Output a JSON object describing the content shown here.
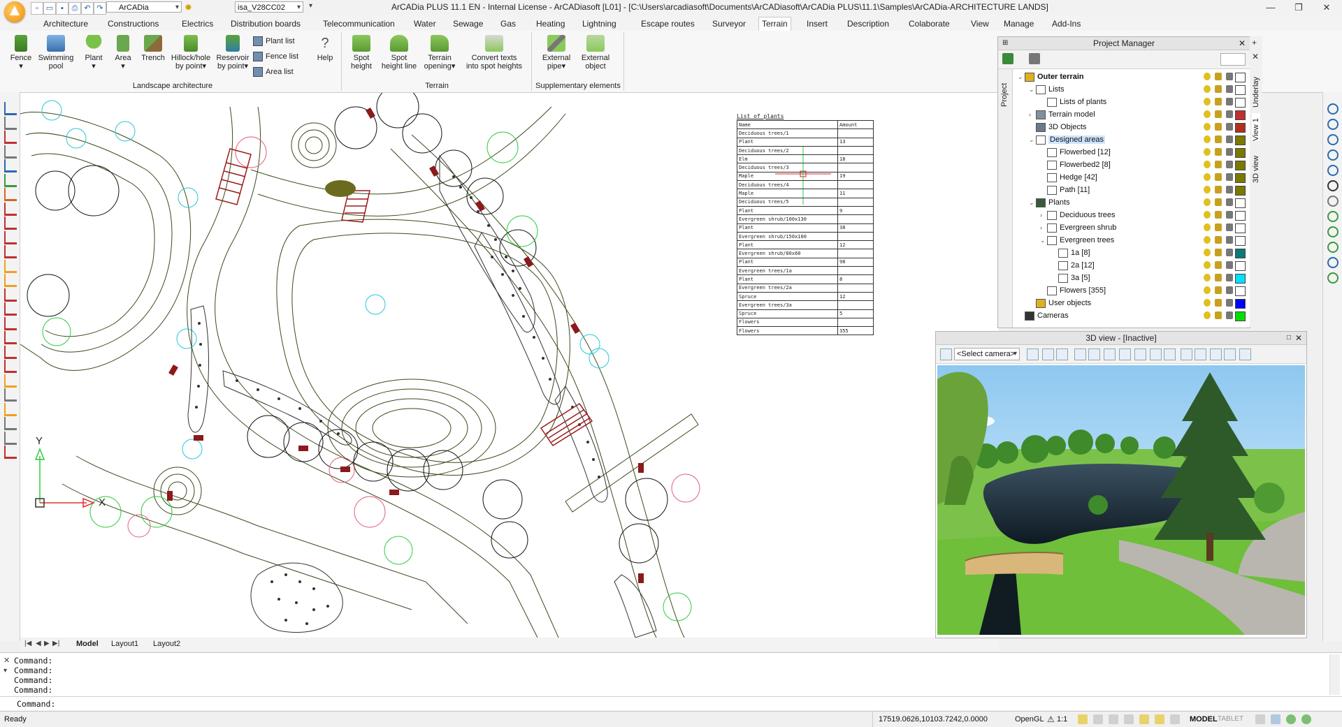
{
  "titlebar": {
    "workspace_combo": "ArCADia",
    "file_combo": "isa_V28CC02",
    "title": "ArCADia PLUS 11.1 EN - Internal License - ArCADiasoft [L01] - [C:\\Users\\arcadiasoft\\Documents\\ArCADiasoft\\ArCADia PLUS\\11.1\\Samples\\ArCADia-ARCHITECTURE LANDS]"
  },
  "ribbon_tabs": [
    "Architecture",
    "Constructions",
    "Electrics",
    "Distribution boards",
    "Telecommunication",
    "Water",
    "Sewage",
    "Gas",
    "Heating",
    "Lightning",
    "Escape routes",
    "Surveyor",
    "Terrain",
    "Insert",
    "Description",
    "Colaborate",
    "View",
    "Manage",
    "Add-Ins"
  ],
  "active_tab": "Terrain",
  "ribbon": {
    "landscape": {
      "label": "Landscape architecture",
      "fence": "Fence",
      "pool_1": "Swimming",
      "pool_2": "pool",
      "plant": "Plant",
      "area": "Area",
      "trench": "Trench",
      "hillock_1": "Hillock/hole",
      "hillock_2": "by point",
      "reservoir_1": "Reservoir",
      "reservoir_2": "by point",
      "plant_list": "Plant list",
      "fence_list": "Fence list",
      "area_list": "Area list",
      "help": "Help"
    },
    "terrain": {
      "label": "Terrain",
      "spot_height_1": "Spot",
      "spot_height_2": "height",
      "spot_line_1": "Spot",
      "spot_line_2": "height line",
      "opening_1": "Terrain",
      "opening_2": "opening",
      "convert_1": "Convert texts",
      "convert_2": "into spot heights"
    },
    "supplementary": {
      "label": "Supplementary elements",
      "pipe_1": "External",
      "pipe_2": "pipe",
      "object_1": "External",
      "object_2": "object"
    }
  },
  "plant_table": {
    "title": "List of plants",
    "header": [
      "Name",
      "Amount"
    ],
    "rows": [
      [
        "Deciduous trees/1",
        ""
      ],
      [
        "Plant",
        "13"
      ],
      [
        "Deciduous trees/2",
        ""
      ],
      [
        "Elm",
        "18"
      ],
      [
        "Deciduous trees/3",
        ""
      ],
      [
        "Maple",
        "19"
      ],
      [
        "Deciduous trees/4",
        ""
      ],
      [
        "Maple",
        "11"
      ],
      [
        "Deciduous trees/5",
        ""
      ],
      [
        "Plant",
        "9"
      ],
      [
        "Evergreen shrub/100x130",
        ""
      ],
      [
        "Plant",
        "38"
      ],
      [
        "Evergreen shrub/150x100",
        ""
      ],
      [
        "Plant",
        "12"
      ],
      [
        "Evergreen shrub/80x60",
        ""
      ],
      [
        "Plant",
        "98"
      ],
      [
        "Evergreen trees/1a",
        ""
      ],
      [
        "Plant",
        "8"
      ],
      [
        "Evergreen trees/2a",
        ""
      ],
      [
        "Spruce",
        "12"
      ],
      [
        "Evergreen trees/3a",
        ""
      ],
      [
        "Spruce",
        "5"
      ],
      [
        "Flowers",
        ""
      ],
      [
        "Flowers",
        "355"
      ]
    ]
  },
  "axes": {
    "x_label": "X",
    "y_label": "Y"
  },
  "project_manager": {
    "title": "Project Manager",
    "side_tabs": [
      "Project"
    ],
    "right_tabs": [
      "Underlay",
      "View 1",
      "3D view"
    ],
    "tree": [
      {
        "label": "Outer terrain",
        "indent": 0,
        "toggle": "⌄",
        "bold": true,
        "swatch": "#ffffff",
        "icon": "#e0b020"
      },
      {
        "label": "Lists",
        "indent": 1,
        "toggle": "⌄",
        "swatch": "#ffffff",
        "icon": "#ffffff"
      },
      {
        "label": "Lists of plants",
        "indent": 2,
        "toggle": "",
        "swatch": "#ffffff",
        "icon": "#ffffff"
      },
      {
        "label": "Terrain model",
        "indent": 1,
        "toggle": "›",
        "swatch": "#c03030",
        "icon": "#8090a0"
      },
      {
        "label": "3D Objects",
        "indent": 1,
        "toggle": "",
        "swatch": "#b03020",
        "icon": "#6a7a8a"
      },
      {
        "label": "Designed areas",
        "indent": 1,
        "toggle": "⌄",
        "selected": true,
        "swatch": "#7a7a00",
        "icon": "#ffffff"
      },
      {
        "label": "Flowerbed [12]",
        "indent": 2,
        "toggle": "",
        "swatch": "#7a7a00",
        "icon": "#ffffff"
      },
      {
        "label": "Flowerbed2 [8]",
        "indent": 2,
        "toggle": "",
        "swatch": "#7a7a00",
        "icon": "#ffffff"
      },
      {
        "label": "Hedge [42]",
        "indent": 2,
        "toggle": "",
        "swatch": "#7a7a00",
        "icon": "#ffffff"
      },
      {
        "label": "Path [11]",
        "indent": 2,
        "toggle": "",
        "swatch": "#7a7a00",
        "icon": "#ffffff"
      },
      {
        "label": "Plants",
        "indent": 1,
        "toggle": "⌄",
        "swatch": "#ffffff",
        "icon": "#3a5a3a"
      },
      {
        "label": "Deciduous trees",
        "indent": 2,
        "toggle": "›",
        "swatch": "#ffffff",
        "icon": "#ffffff"
      },
      {
        "label": "Evergreen shrub",
        "indent": 2,
        "toggle": "›",
        "swatch": "#ffffff",
        "icon": "#ffffff"
      },
      {
        "label": "Evergreen trees",
        "indent": 2,
        "toggle": "⌄",
        "swatch": "#ffffff",
        "icon": "#ffffff"
      },
      {
        "label": "1a [8]",
        "indent": 3,
        "toggle": "",
        "swatch": "#0a7a7a",
        "icon": "#ffffff"
      },
      {
        "label": "2a [12]",
        "indent": 3,
        "toggle": "",
        "swatch": "#ffffff",
        "icon": "#ffffff"
      },
      {
        "label": "3a [5]",
        "indent": 3,
        "toggle": "",
        "swatch": "#00e0ff",
        "icon": "#ffffff"
      },
      {
        "label": "Flowers [355]",
        "indent": 2,
        "toggle": "",
        "swatch": "#ffffff",
        "icon": "#ffffff"
      },
      {
        "label": "User objects",
        "indent": 1,
        "toggle": "",
        "swatch": "#0000ff",
        "icon": "#e0b020"
      },
      {
        "label": "Cameras",
        "indent": 0,
        "toggle": "",
        "swatch": "#00e000",
        "icon": "#333333"
      }
    ]
  },
  "view3d": {
    "title": "3D view - [Inactive]",
    "camera_placeholder": "<Select camera>"
  },
  "layout_tabs": [
    "Model",
    "Layout1",
    "Layout2"
  ],
  "command": {
    "lines": [
      "Command:",
      "Command:",
      "Command:",
      "Command:"
    ],
    "prompt": "Command:"
  },
  "status": {
    "ready": "Ready",
    "coords": "17519.0626,10103.7242,0.0000",
    "renderer": "OpenGL",
    "scale": "1:1",
    "model": "MODEL",
    "tablet": "TABLET"
  }
}
